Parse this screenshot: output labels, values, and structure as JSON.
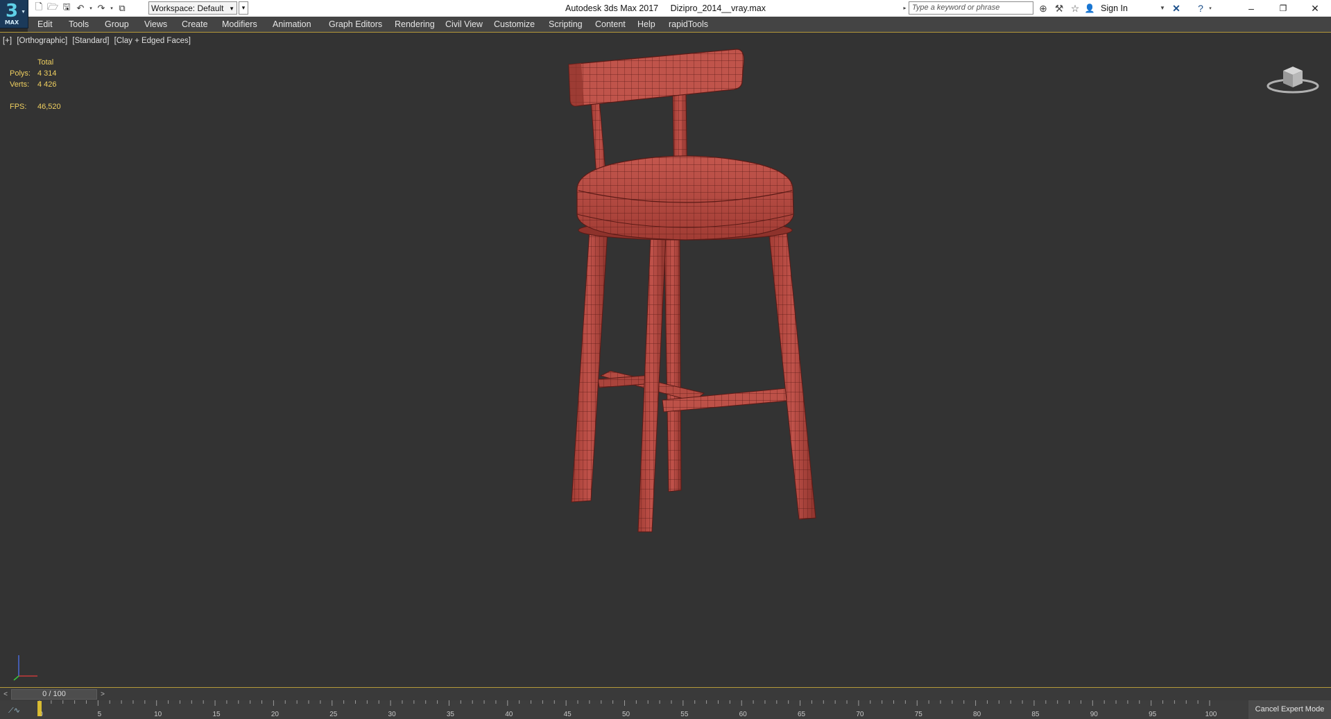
{
  "title_bar": {
    "logo_number": "3",
    "logo_text": "MAX",
    "workspace": "Workspace: Default",
    "app_title": "Autodesk 3ds Max 2017",
    "file_name": "Dizipro_2014__vray.max",
    "search_placeholder": "Type a keyword or phrase",
    "sign_in": "Sign In"
  },
  "menu": {
    "items": [
      "Edit",
      "Tools",
      "Group",
      "Views",
      "Create",
      "Modifiers",
      "Animation",
      "Graph Editors",
      "Rendering",
      "Civil View",
      "Customize",
      "Scripting",
      "Content",
      "Help",
      "rapidTools"
    ]
  },
  "viewport": {
    "label_parts": [
      "[+]",
      "[Orthographic]",
      "[Standard]",
      "[Clay + Edged Faces]"
    ],
    "stats": {
      "header": "Total",
      "polys_label": "Polys:",
      "polys_value": "4 314",
      "verts_label": "Verts:",
      "verts_value": "4 426",
      "fps_label": "FPS:",
      "fps_value": "46,520"
    },
    "model_color": "#b8483f",
    "edge_color": "#5a1a16"
  },
  "timeline": {
    "frame_display": "0 / 100",
    "prev": "<",
    "next": ">",
    "ticks": [
      0,
      5,
      10,
      15,
      20,
      25,
      30,
      35,
      40,
      45,
      50,
      55,
      60,
      65,
      70,
      75,
      80,
      85,
      90,
      95,
      100
    ],
    "cancel_expert": "Cancel Expert Mode"
  },
  "colors": {
    "accent_gold": "#b59a3a",
    "stats_text": "#f0d060",
    "viewport_bg": "#333333"
  }
}
